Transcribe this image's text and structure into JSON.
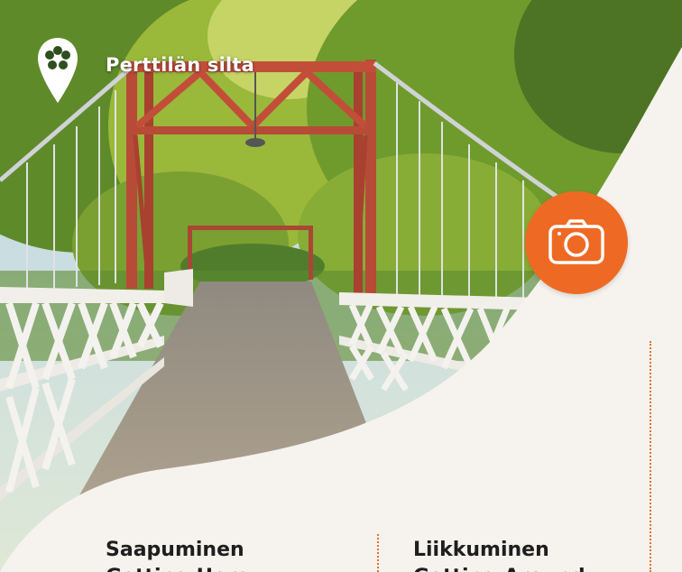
{
  "place": {
    "title": "Perttilän silta",
    "pin_icon": "flower-pin-icon"
  },
  "actions": {
    "camera_icon": "camera-icon"
  },
  "columns": [
    {
      "title": "Saapuminen",
      "subtitle": "Getting Here"
    },
    {
      "title": "Liikkuminen",
      "subtitle": "Getting Around"
    }
  ],
  "colors": {
    "accent": "#ee6a24",
    "panel": "#f6f3ee",
    "text": "#1e1e1e"
  }
}
